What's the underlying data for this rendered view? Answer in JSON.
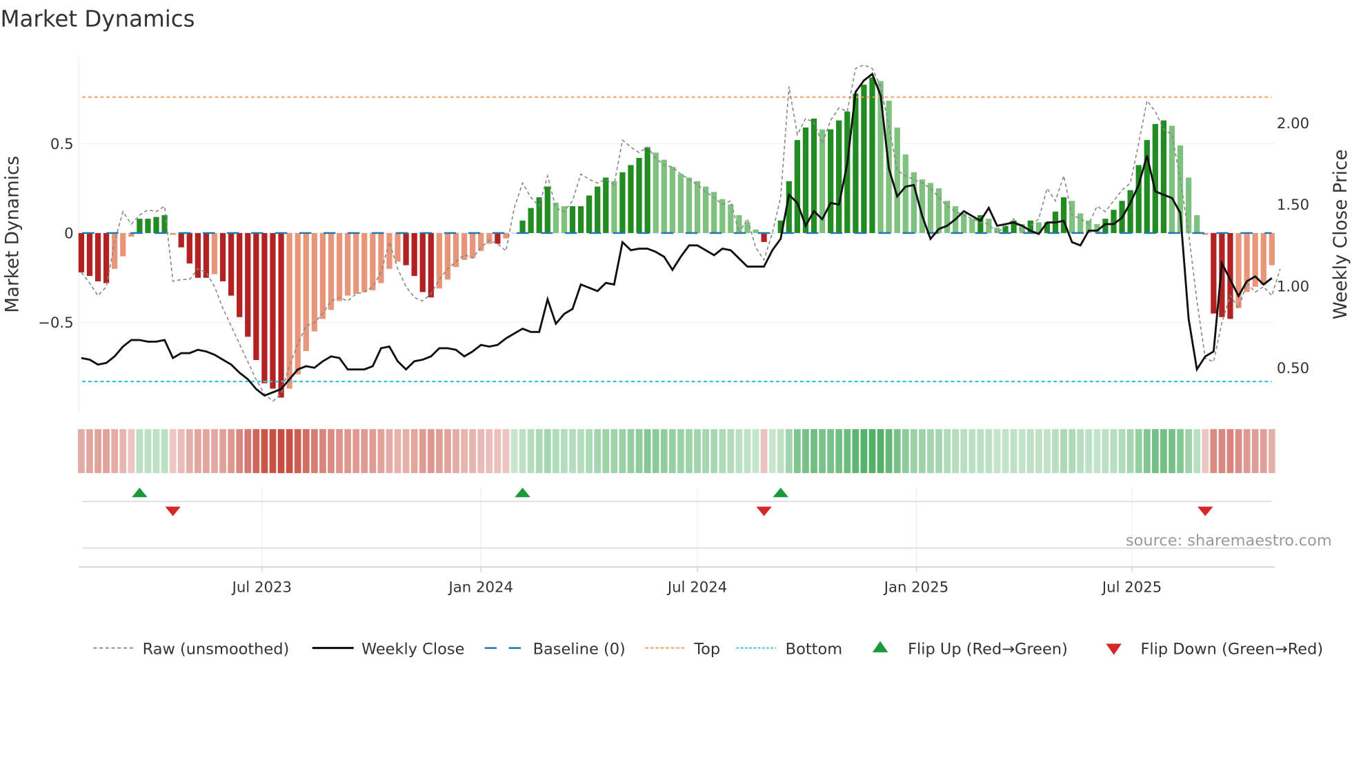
{
  "chart_data": {
    "type": "bar",
    "title": "Market Dynamics",
    "ylabel": "Market Dynamics",
    "y2label": "Weekly Close Price",
    "ylim": [
      -1.0,
      0.99
    ],
    "y2lim": [
      0.23,
      2.41
    ],
    "yticks": [
      {
        "value": 0.5,
        "label": "0.5"
      },
      {
        "value": 0,
        "label": "0"
      },
      {
        "value": -0.5,
        "label": "−0.5"
      }
    ],
    "y2ticks": [
      {
        "value": 2.0,
        "label": "2.00"
      },
      {
        "value": 1.5,
        "label": "1.50"
      },
      {
        "value": 1.0,
        "label": "1.00"
      },
      {
        "value": 0.5,
        "label": "0.50"
      }
    ],
    "top_level": 0.76,
    "bottom_level": -0.83,
    "baseline": 0,
    "x_ticks": [
      {
        "label": "Jul 2023",
        "week": 21.7
      },
      {
        "label": "Jan 2024",
        "week": 48.0
      },
      {
        "label": "Jul 2024",
        "week": 74.0
      },
      {
        "label": "Jan 2025",
        "week": 100.3
      },
      {
        "label": "Jul 2025",
        "week": 126.2
      }
    ],
    "dynamics": [
      -0.22,
      -0.24,
      -0.27,
      -0.28,
      -0.2,
      -0.13,
      -0.02,
      0.08,
      0.08,
      0.09,
      0.1,
      -0.01,
      -0.08,
      -0.17,
      -0.25,
      -0.25,
      -0.23,
      -0.27,
      -0.35,
      -0.47,
      -0.58,
      -0.71,
      -0.84,
      -0.87,
      -0.92,
      -0.87,
      -0.79,
      -0.66,
      -0.55,
      -0.48,
      -0.43,
      -0.38,
      -0.35,
      -0.34,
      -0.33,
      -0.32,
      -0.28,
      -0.2,
      -0.16,
      -0.18,
      -0.24,
      -0.33,
      -0.36,
      -0.31,
      -0.26,
      -0.19,
      -0.15,
      -0.14,
      -0.1,
      -0.06,
      -0.06,
      -0.03,
      0.0,
      0.07,
      0.14,
      0.2,
      0.26,
      0.17,
      0.15,
      0.15,
      0.15,
      0.21,
      0.26,
      0.31,
      0.29,
      0.34,
      0.38,
      0.42,
      0.48,
      0.45,
      0.41,
      0.37,
      0.33,
      0.31,
      0.29,
      0.26,
      0.23,
      0.19,
      0.16,
      0.1,
      0.06,
      0.02,
      -0.05,
      0.0,
      0.07,
      0.29,
      0.52,
      0.59,
      0.64,
      0.58,
      0.58,
      0.63,
      0.68,
      0.78,
      0.83,
      0.87,
      0.85,
      0.74,
      0.59,
      0.44,
      0.34,
      0.3,
      0.28,
      0.25,
      0.18,
      0.15,
      0.11,
      0.08,
      0.1,
      0.08,
      0.03,
      0.04,
      0.07,
      0.05,
      0.07,
      0.06,
      0.06,
      0.12,
      0.2,
      0.18,
      0.11,
      0.07,
      0.05,
      0.08,
      0.13,
      0.18,
      0.24,
      0.38,
      0.52,
      0.61,
      0.63,
      0.6,
      0.49,
      0.31,
      0.1,
      -0.01,
      -0.45,
      -0.47,
      -0.48,
      -0.42,
      -0.33,
      -0.3,
      -0.29,
      -0.18
    ],
    "raw": [
      -0.22,
      -0.28,
      -0.35,
      -0.3,
      -0.05,
      0.12,
      0.05,
      0.1,
      0.13,
      0.12,
      0.15,
      -0.27,
      -0.26,
      -0.26,
      -0.2,
      -0.22,
      -0.3,
      -0.42,
      -0.52,
      -0.62,
      -0.72,
      -0.82,
      -0.9,
      -0.94,
      -0.9,
      -0.74,
      -0.62,
      -0.52,
      -0.5,
      -0.45,
      -0.38,
      -0.36,
      -0.38,
      -0.34,
      -0.33,
      -0.3,
      -0.22,
      -0.05,
      -0.2,
      -0.3,
      -0.36,
      -0.38,
      -0.34,
      -0.26,
      -0.2,
      -0.16,
      -0.12,
      -0.14,
      -0.08,
      -0.04,
      -0.06,
      -0.1,
      0.14,
      0.28,
      0.2,
      0.15,
      0.32,
      0.14,
      0.12,
      0.18,
      0.33,
      0.3,
      0.28,
      0.3,
      0.27,
      0.52,
      0.48,
      0.45,
      0.48,
      0.42,
      0.38,
      0.37,
      0.33,
      0.3,
      0.27,
      0.23,
      0.2,
      0.16,
      0.18,
      0.0,
      0.08,
      -0.08,
      -0.15,
      0.0,
      0.2,
      0.82,
      0.55,
      0.64,
      0.62,
      0.5,
      0.63,
      0.7,
      0.68,
      0.92,
      0.94,
      0.92,
      0.82,
      0.6,
      0.35,
      0.32,
      0.3,
      0.28,
      0.25,
      0.2,
      0.15,
      0.12,
      0.1,
      0.08,
      0.06,
      0.05,
      0.0,
      0.04,
      0.08,
      0.0,
      0.04,
      0.08,
      0.25,
      0.18,
      0.32,
      0.1,
      0.08,
      0.05,
      0.15,
      0.12,
      0.18,
      0.24,
      0.28,
      0.5,
      0.74,
      0.68,
      0.58,
      0.55,
      0.3,
      0.0,
      -0.38,
      -0.7,
      -0.72,
      -0.5,
      -0.35,
      -0.42,
      -0.28,
      -0.33,
      -0.3,
      -0.35,
      -0.2
    ],
    "weekly_close": [
      0.56,
      0.55,
      0.52,
      0.53,
      0.57,
      0.63,
      0.67,
      0.67,
      0.66,
      0.66,
      0.67,
      0.56,
      0.59,
      0.59,
      0.61,
      0.6,
      0.58,
      0.55,
      0.52,
      0.47,
      0.43,
      0.37,
      0.33,
      0.35,
      0.37,
      0.43,
      0.49,
      0.51,
      0.5,
      0.54,
      0.57,
      0.56,
      0.49,
      0.49,
      0.49,
      0.51,
      0.62,
      0.63,
      0.54,
      0.49,
      0.54,
      0.55,
      0.57,
      0.62,
      0.62,
      0.61,
      0.57,
      0.6,
      0.64,
      0.63,
      0.64,
      0.68,
      0.71,
      0.74,
      0.72,
      0.72,
      0.92,
      0.77,
      0.83,
      0.86,
      1.01,
      0.99,
      0.97,
      1.02,
      1.01,
      1.27,
      1.22,
      1.23,
      1.23,
      1.21,
      1.18,
      1.1,
      1.18,
      1.25,
      1.25,
      1.22,
      1.19,
      1.23,
      1.22,
      1.17,
      1.12,
      1.12,
      1.12,
      1.22,
      1.29,
      1.56,
      1.51,
      1.37,
      1.46,
      1.41,
      1.51,
      1.5,
      1.75,
      2.19,
      2.26,
      2.3,
      2.17,
      1.72,
      1.55,
      1.61,
      1.62,
      1.43,
      1.29,
      1.35,
      1.37,
      1.41,
      1.46,
      1.43,
      1.4,
      1.48,
      1.37,
      1.38,
      1.39,
      1.37,
      1.34,
      1.32,
      1.39,
      1.39,
      1.4,
      1.27,
      1.25,
      1.34,
      1.34,
      1.38,
      1.38,
      1.42,
      1.51,
      1.62,
      1.8,
      1.58,
      1.56,
      1.54,
      1.45,
      0.8,
      0.49,
      0.57,
      0.6,
      1.14,
      1.04,
      0.94,
      1.03,
      1.06,
      1.01,
      1.05
    ],
    "flips_up_weeks": [
      7,
      53,
      84
    ],
    "flips_down_weeks": [
      11,
      82,
      135
    ],
    "legend": {
      "raw": "Raw (unsmoothed)",
      "close": "Weekly Close",
      "baseline": "Baseline (0)",
      "top": "Top",
      "bottom": "Bottom",
      "flip_up": "Flip Up (Red→Green)",
      "flip_down": "Flip Down (Green→Red)"
    },
    "legend_placement": "bottom"
  },
  "source": "source: sharemaestro.com",
  "colors": {
    "dark_red": "#b22222",
    "light_red": "#e8967a",
    "dark_green": "#228b22",
    "light_green": "#7fc17f",
    "top": "#f0a060",
    "bottom": "#2ec4d0",
    "baseline": "#1f77b4",
    "flip_up": "#1a9a3a",
    "flip_down": "#d62728"
  }
}
